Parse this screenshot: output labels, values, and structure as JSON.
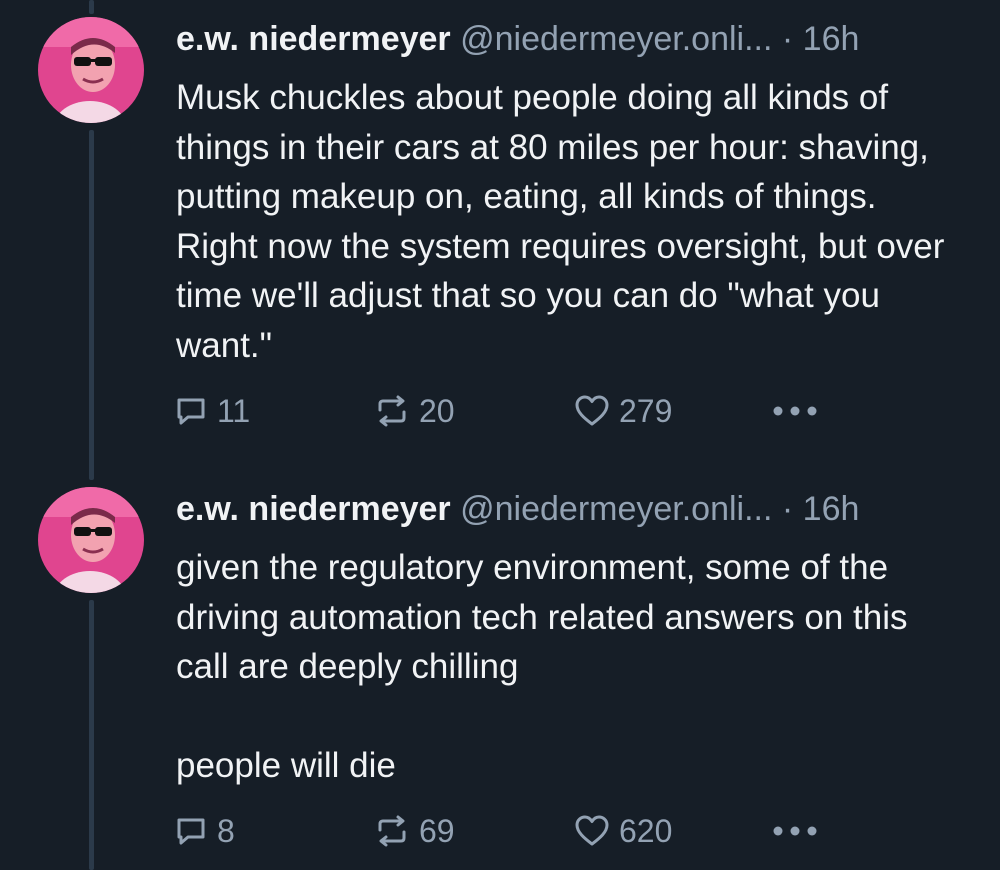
{
  "colors": {
    "background": "#161e27",
    "text_primary": "#f1f3f5",
    "text_secondary": "#93a2b3",
    "thread_line": "#2b3a4a"
  },
  "posts": [
    {
      "author_name": "e.w. niedermeyer",
      "author_handle": "@niedermeyer.onli...",
      "separator": "·",
      "time": "16h",
      "paragraphs": [
        "Musk chuckles about people doing all kinds of things in their cars at 80 miles per hour: shaving, putting makeup on, eating, all kinds of things. Right now the system requires oversight, but over time we'll adjust that so you can do \"what you want.\""
      ],
      "reply_count": "11",
      "repost_count": "20",
      "like_count": "279",
      "icons": {
        "avatar": "avatar-photo",
        "reply": "reply-icon",
        "repost": "repost-icon",
        "like": "heart-icon",
        "more": "more-icon"
      }
    },
    {
      "author_name": "e.w. niedermeyer",
      "author_handle": "@niedermeyer.onli...",
      "separator": "·",
      "time": "16h",
      "paragraphs": [
        "given the regulatory environment, some of the driving automation tech related answers on this call are deeply chilling",
        "people will die"
      ],
      "reply_count": "8",
      "repost_count": "69",
      "like_count": "620",
      "icons": {
        "avatar": "avatar-photo",
        "reply": "reply-icon",
        "repost": "repost-icon",
        "like": "heart-icon",
        "more": "more-icon"
      }
    }
  ]
}
